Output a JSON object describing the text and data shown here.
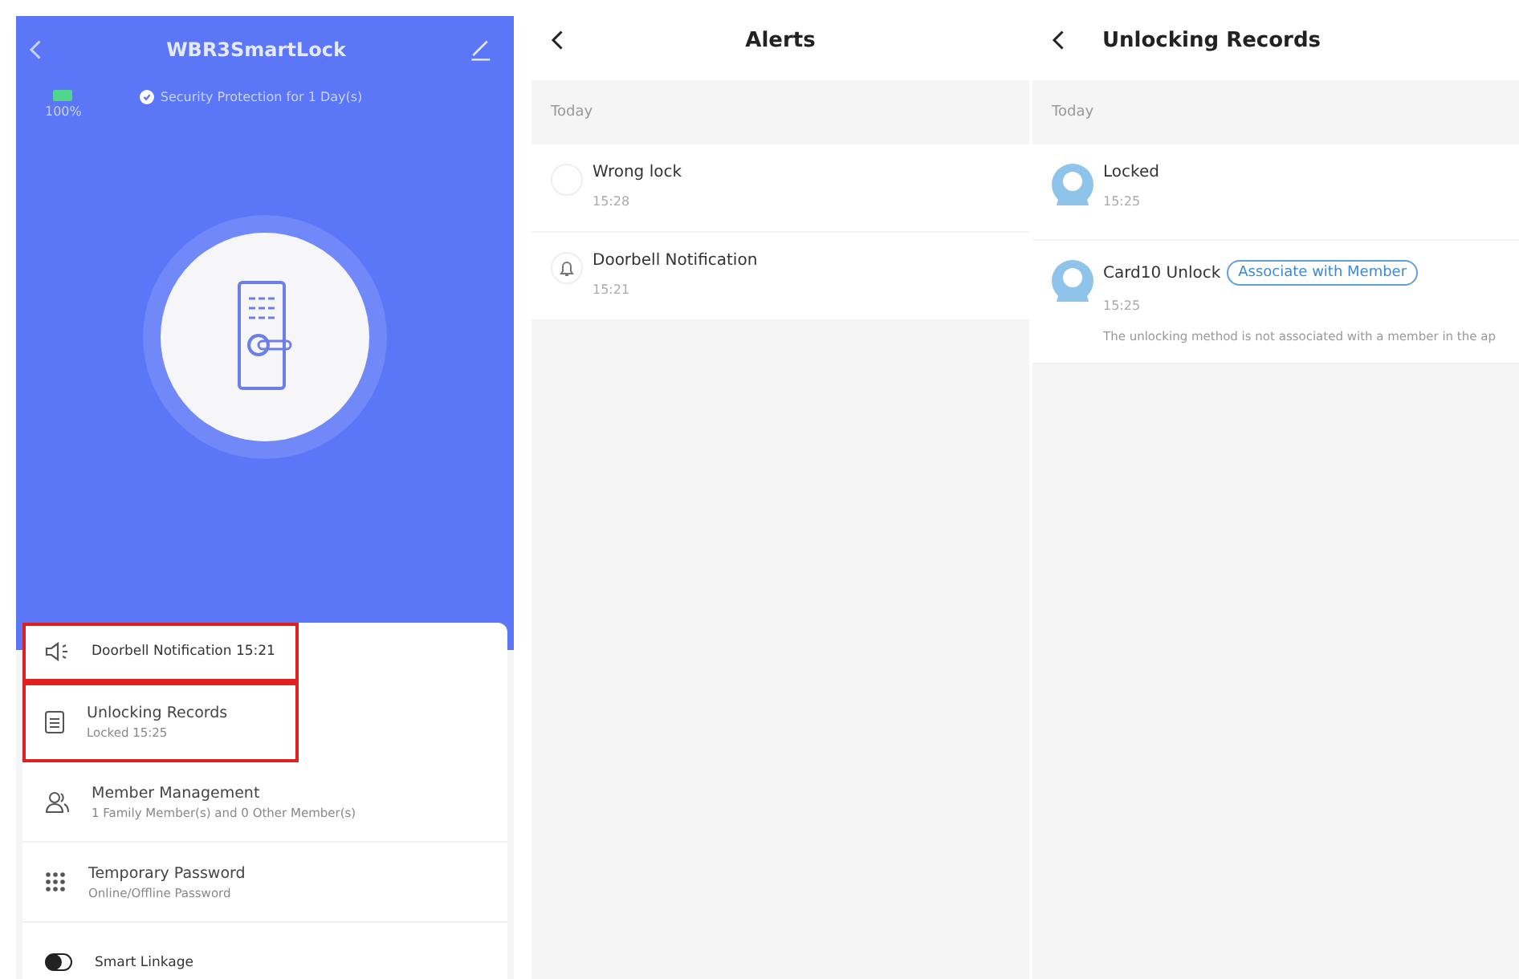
{
  "lock_screen": {
    "title": "WBR3SmartLock",
    "battery": "100%",
    "security": "Security Protection for 1 Day(s)",
    "menu": [
      {
        "kind": "speaker",
        "title": "Doorbell Notification 15:21",
        "highlighted": true
      },
      {
        "kind": "records",
        "title": "Unlocking Records",
        "subtitle": "Locked 15:25",
        "highlighted": true
      },
      {
        "kind": "members",
        "title": "Member Management",
        "subtitle": "1 Family Member(s) and 0 Other Member(s)",
        "highlighted": false
      },
      {
        "kind": "password",
        "title": "Temporary Password",
        "subtitle": "Online/Offline Password",
        "highlighted": false
      },
      {
        "kind": "toggle",
        "title": "Smart Linkage",
        "highlighted": false
      }
    ]
  },
  "alerts": {
    "title": "Alerts",
    "section": "Today",
    "items": [
      {
        "kind": "blank",
        "title": "Wrong lock",
        "time": "15:28"
      },
      {
        "kind": "bell",
        "title": "Doorbell Notification",
        "time": "15:21"
      }
    ]
  },
  "records": {
    "title": "Unlocking Records",
    "section": "Today",
    "items": [
      {
        "title": "Locked",
        "time": "15:25"
      },
      {
        "title": "Card10 Unlock",
        "button": "Associate with Member",
        "time": "15:25",
        "note": "The unlocking method is not associated with a member in the ap"
      }
    ]
  }
}
